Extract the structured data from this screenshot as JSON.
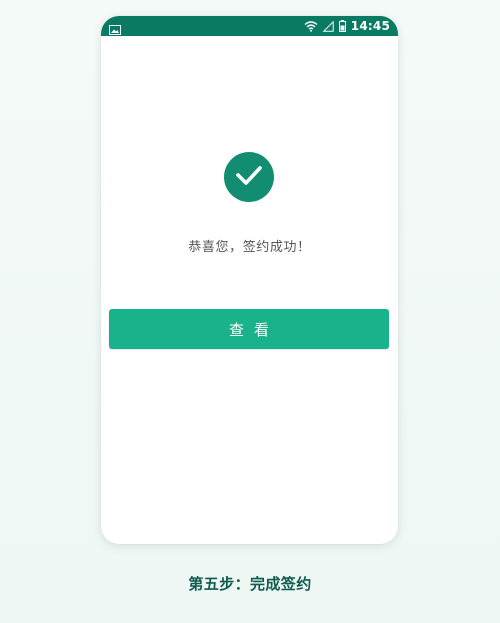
{
  "status_bar": {
    "time": "14:45",
    "icons": [
      "image-icon",
      "wifi-icon",
      "signal-icon",
      "battery-icon"
    ],
    "background": "#0b7a63"
  },
  "result": {
    "icon": "check-icon",
    "message": "恭喜您，签约成功！",
    "accent": "#138d72"
  },
  "actions": {
    "view_label": "查看",
    "button_color": "#1ab28b"
  },
  "caption": {
    "text": "第五步：完成签约"
  }
}
